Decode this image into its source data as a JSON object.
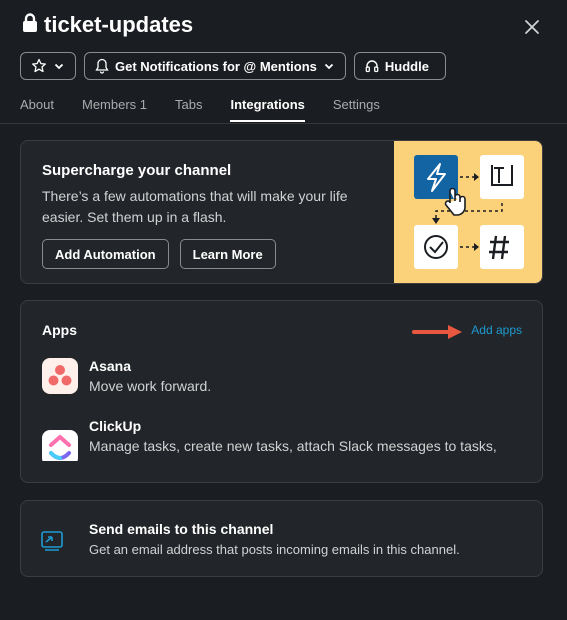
{
  "header": {
    "title": "ticket-updates",
    "notifications_label": "Get Notifications for @ Mentions",
    "huddle_label": "Huddle"
  },
  "tabs": [
    {
      "label": "About"
    },
    {
      "label": "Members 1"
    },
    {
      "label": "Tabs"
    },
    {
      "label": "Integrations",
      "active": true
    },
    {
      "label": "Settings"
    }
  ],
  "promo": {
    "title": "Supercharge your channel",
    "description": "There’s a few automations that will make your life easier. Set them up in a flash.",
    "add_automation_label": "Add Automation",
    "learn_more_label": "Learn More"
  },
  "apps": {
    "heading": "Apps",
    "add_label": "Add apps",
    "items": [
      {
        "name": "Asana",
        "description": "Move work forward."
      },
      {
        "name": "ClickUp",
        "description": "Manage tasks, create new tasks, attach Slack messages to tasks,"
      }
    ]
  },
  "email": {
    "title": "Send emails to this channel",
    "description": "Get an email address that posts incoming emails in this channel."
  },
  "colors": {
    "background": "#1a1d21",
    "card": "#222529",
    "link": "#1d9bd1",
    "illustration": "#fbd27a",
    "arrow": "#e8573f"
  }
}
